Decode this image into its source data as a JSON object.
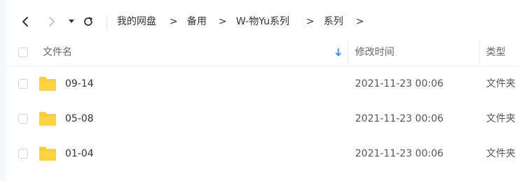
{
  "nav": {
    "back_icon": "chevron-left-icon",
    "forward_icon": "chevron-right-icon",
    "history_icon": "caret-down-icon",
    "refresh_icon": "refresh-icon",
    "breadcrumb": [
      "我的网盘",
      "备用",
      "W-物Yu系列",
      "系列"
    ],
    "separator": ">"
  },
  "table": {
    "columns": {
      "name": "文件名",
      "modified": "修改时间",
      "type": "类型"
    },
    "sort_icon": "sort-down-arrow-icon",
    "sort_color": "#1a8cff",
    "folder_color": "#ffcc33",
    "rows": [
      {
        "name": "09-14",
        "modified": "2021-11-23 00:06",
        "type": "文件夹"
      },
      {
        "name": "05-08",
        "modified": "2021-11-23 00:06",
        "type": "文件夹"
      },
      {
        "name": "01-04",
        "modified": "2021-11-23 00:06",
        "type": "文件夹"
      }
    ]
  }
}
